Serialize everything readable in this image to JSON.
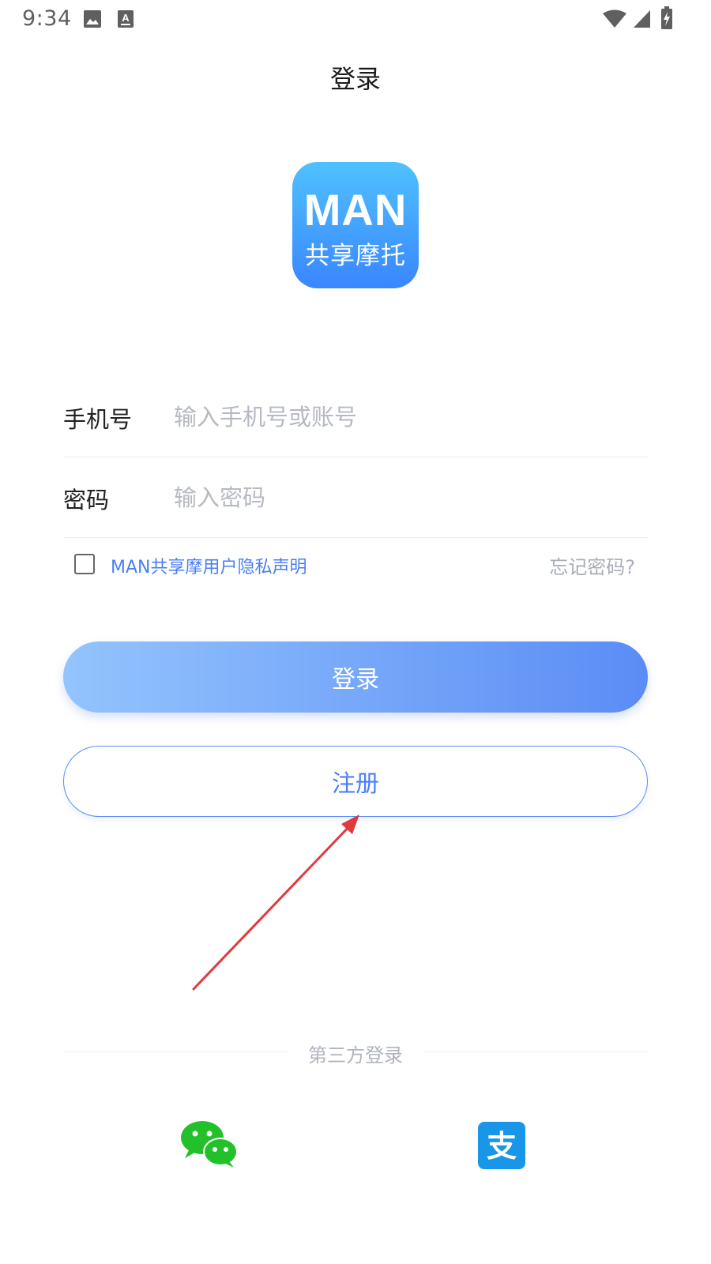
{
  "status_bar": {
    "time": "9:34",
    "icons": [
      "image-icon",
      "font-icon",
      "wifi-icon",
      "signal-icon",
      "battery-charging-icon"
    ]
  },
  "header": {
    "title": "登录"
  },
  "logo": {
    "main_text": "MAN",
    "sub_text": "共享摩托"
  },
  "form": {
    "phone": {
      "label": "手机号",
      "placeholder": "输入手机号或账号",
      "value": ""
    },
    "password": {
      "label": "密码",
      "placeholder": "输入密码",
      "value": ""
    }
  },
  "privacy": {
    "checked": false,
    "link_text": "MAN共享摩用户隐私声明",
    "forgot_text": "忘记密码?"
  },
  "buttons": {
    "login_label": "登录",
    "register_label": "注册"
  },
  "third_party": {
    "label": "第三方登录",
    "providers": [
      {
        "name": "wechat",
        "icon": "wechat-icon"
      },
      {
        "name": "alipay",
        "icon": "alipay-icon",
        "glyph": "支"
      }
    ]
  },
  "colors": {
    "accent": "#4a7ef5",
    "login_gradient_start": "#93c4fd",
    "login_gradient_end": "#5b8cf5",
    "logo_gradient_top": "#4fc1ff",
    "logo_gradient_bottom": "#3a86ff",
    "wechat_green": "#22c12a",
    "alipay_blue": "#1a96e8",
    "annotation_red": "#e0393e"
  }
}
